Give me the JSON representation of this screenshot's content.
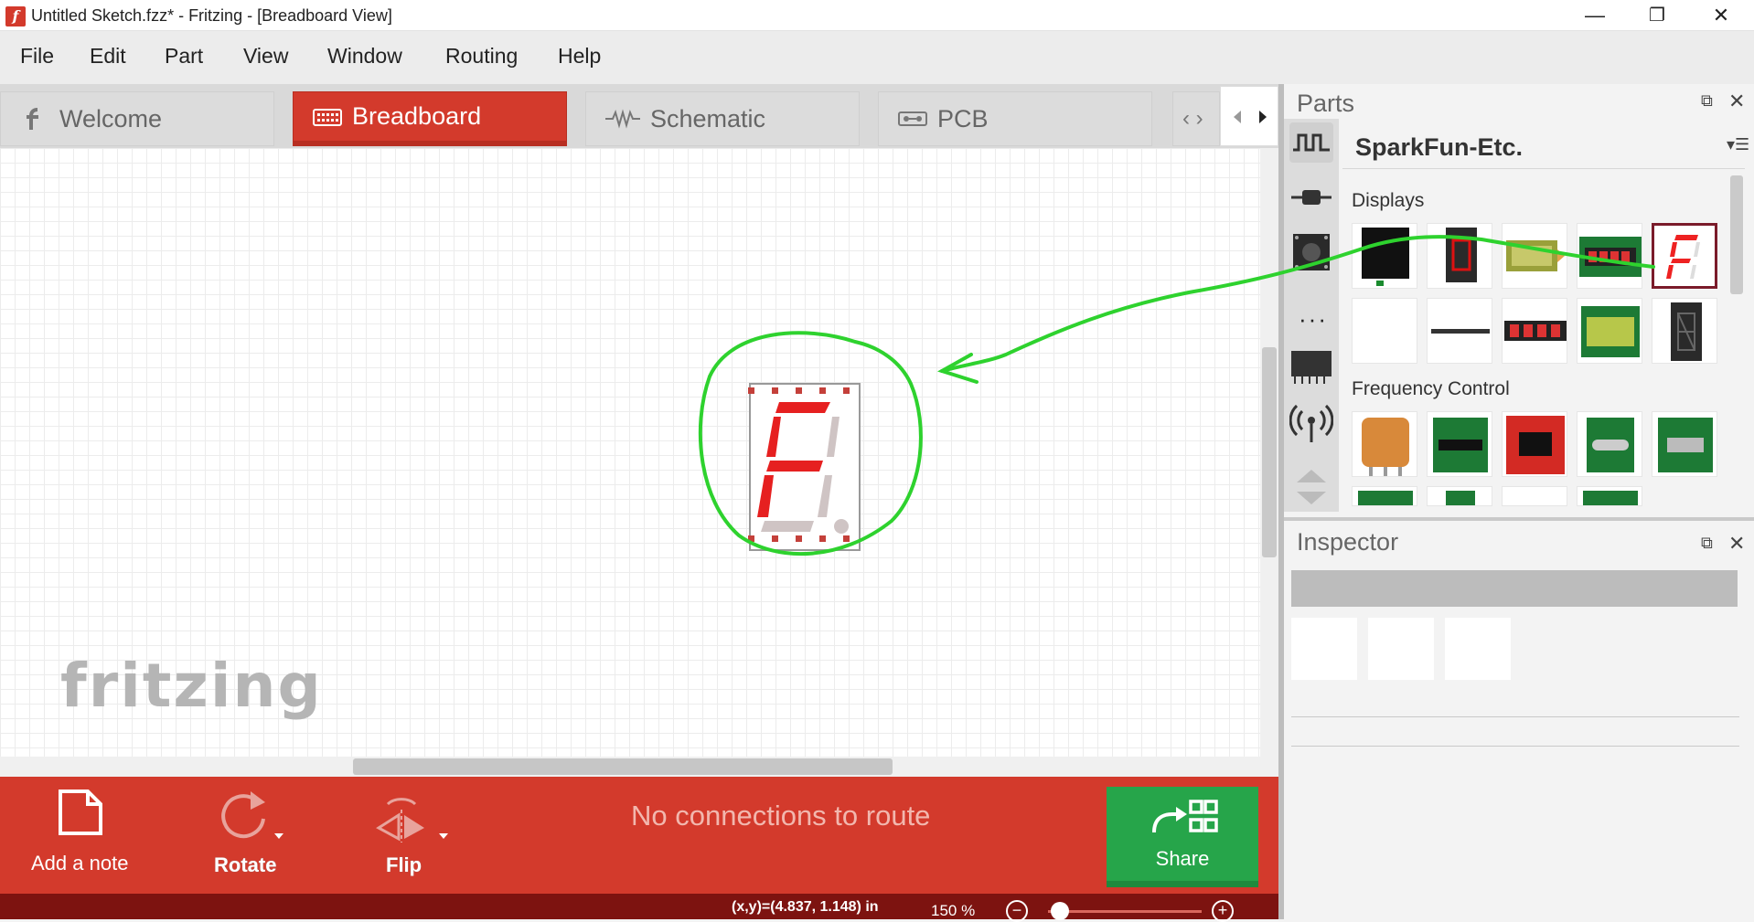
{
  "window": {
    "title": "Untitled Sketch.fzz* - Fritzing - [Breadboard View]",
    "app_icon_letter": "f",
    "controls": {
      "minimize": "—",
      "maximize": "❐",
      "close": "✕"
    }
  },
  "menu": [
    "File",
    "Edit",
    "Part",
    "View",
    "Window",
    "Routing",
    "Help"
  ],
  "tabs": [
    {
      "label": "Welcome",
      "icon": "fritzing-f-icon",
      "active": false
    },
    {
      "label": "Breadboard",
      "icon": "breadboard-icon",
      "active": true
    },
    {
      "label": "Schematic",
      "icon": "resistor-icon",
      "active": false
    },
    {
      "label": "PCB",
      "icon": "pcb-icon",
      "active": false
    }
  ],
  "tab_nav": "‹ ›",
  "canvas": {
    "watermark": "fritzing",
    "placed_part": "seven-segment-display",
    "annotation_color": "#2ed22e"
  },
  "toolbar": {
    "add_note": "Add a note",
    "rotate": "Rotate",
    "flip": "Flip",
    "status_message": "No connections to route",
    "share": "Share"
  },
  "statusbar": {
    "coordinates": "(x,y)=(4.837, 1.148) in",
    "zoom": "150 %"
  },
  "parts_panel": {
    "title": "Parts",
    "bin_title": "SparkFun-Etc.",
    "categories": [
      {
        "name": "Displays"
      },
      {
        "name": "Frequency Control"
      }
    ]
  },
  "inspector": {
    "title": "Inspector"
  },
  "colors": {
    "accent_red": "#d33a2c",
    "status_bar": "#7d1310",
    "share_green": "#26a54a"
  }
}
